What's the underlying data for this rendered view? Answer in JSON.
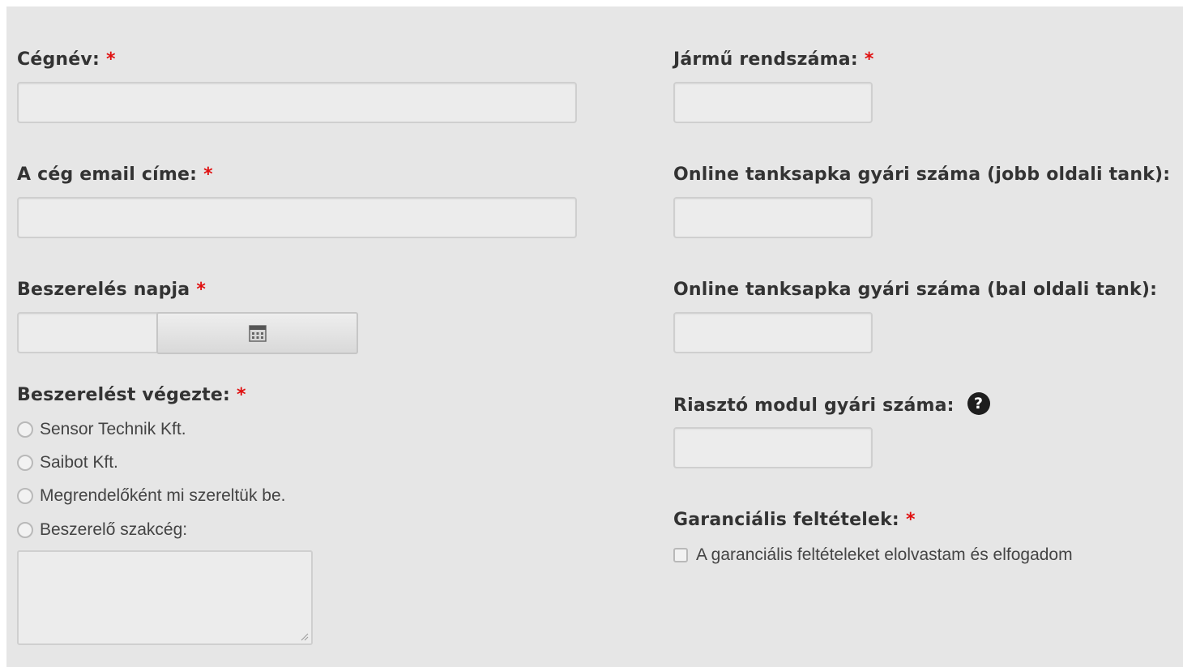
{
  "required_marker": "*",
  "left": {
    "company_name": {
      "label": "Cégnév:"
    },
    "company_email": {
      "label": "A cég email címe:"
    },
    "install_date": {
      "label": "Beszerelés napja"
    },
    "installer": {
      "label": "Beszerelést végezte:",
      "options": [
        "Sensor Technik Kft.",
        "Saibot Kft.",
        "Megrendelőként mi szereltük be.",
        "Beszerelő szakcég:"
      ]
    }
  },
  "right": {
    "plate": {
      "label": "Jármű rendszáma:"
    },
    "tank_right": {
      "label": "Online tanksapka gyári száma (jobb oldali tank):"
    },
    "tank_left": {
      "label": "Online tanksapka gyári száma (bal oldali tank):"
    },
    "alarm": {
      "label": "Riasztó modul gyári száma:",
      "help_icon": "question-circle-icon",
      "help_glyph": "?"
    },
    "warranty": {
      "label": "Garanciális feltételek:",
      "checkbox_label": "A garanciális feltételeket elolvastam és elfogadom"
    }
  },
  "colors": {
    "required": "#e01010",
    "panel_bg": "#e6e6e6",
    "label_text": "#333333"
  }
}
